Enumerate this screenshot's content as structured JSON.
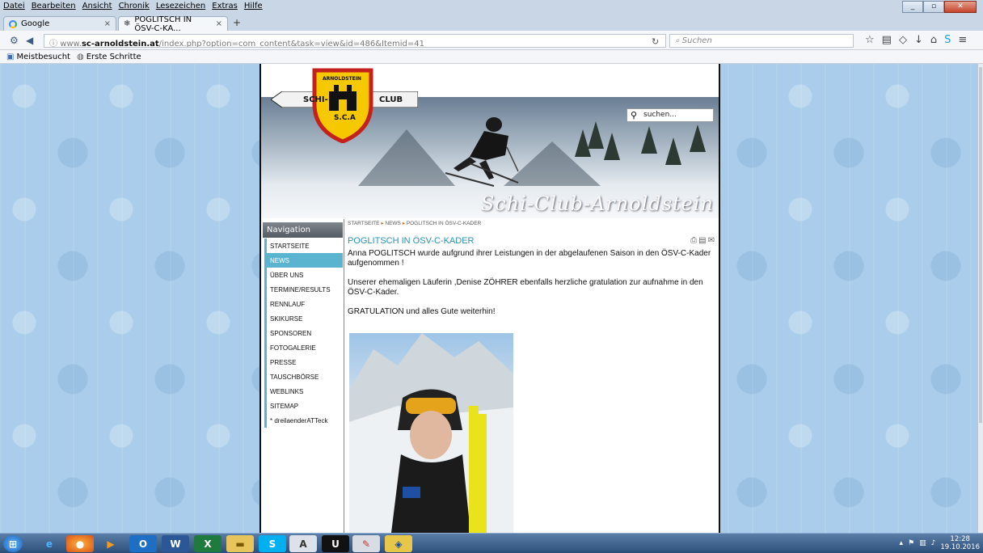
{
  "browser": {
    "menu": [
      "Datei",
      "Bearbeiten",
      "Ansicht",
      "Chronik",
      "Lesezeichen",
      "Extras",
      "Hilfe"
    ],
    "tabs": [
      {
        "label": "Google"
      },
      {
        "label": "POGLITSCH IN ÖSV-C-KA..."
      }
    ],
    "url_prefix": "www.",
    "url_domain": "sc-arnoldstein.at",
    "url_path": "/index.php?option=com_content&task=view&id=486&Itemid=41",
    "search_placeholder": "Suchen",
    "bookmarks": [
      "Meistbesucht",
      "Erste Schritte"
    ]
  },
  "site": {
    "logo_top_text": "ARNOLDSTEIN",
    "logo_ribbon_left": "SCHI-",
    "logo_ribbon_right": "CLUB",
    "logo_bottom_text": "S.C.A",
    "banner_title": "Schi-Club-Arnoldstein",
    "search_placeholder": "suchen...",
    "nav": {
      "heading": "Navigation",
      "items": [
        {
          "label": "STARTSEITE",
          "active": false
        },
        {
          "label": "NEWS",
          "active": true
        },
        {
          "label": "ÜBER UNS",
          "active": false
        },
        {
          "label": "TERMINE/RESULTS",
          "active": false
        },
        {
          "label": "RENNLAUF",
          "active": false
        },
        {
          "label": "SKIKURSE",
          "active": false
        },
        {
          "label": "SPONSOREN",
          "active": false
        },
        {
          "label": "FOTOGALERIE",
          "active": false
        },
        {
          "label": "PRESSE",
          "active": false
        },
        {
          "label": "TAUSCHBÖRSE",
          "active": false
        },
        {
          "label": "WEBLINKS",
          "active": false
        },
        {
          "label": "SITEMAP",
          "active": false
        },
        {
          "label": "* dreilaenderATTeck",
          "active": false
        }
      ]
    },
    "breadcrumb": [
      "STARTSEITE",
      "NEWS",
      "POGLITSCH IN ÖSV-C-KADER"
    ],
    "article": {
      "title": "POGLITSCH IN ÖSV-C-KADER",
      "p1": "Anna POGLITSCH wurde aufgrund ihrer Leistungen in der abgelaufenen Saison in den ÖSV-C-Kader aufgenommen !",
      "p2": "Unserer ehemaligen Läuferin ,Denise ZÖHRER ebenfalls herzliche gratulation zur aufnahme in den ÖSV-C-Kader.",
      "p3": "GRATULATION und alles Gute weiterhin!"
    }
  },
  "taskbar": {
    "time": "12:28",
    "date": "19.10.2016"
  },
  "colors": {
    "accent": "#5ab4cf",
    "title": "#2a8fb5",
    "page_bg": "#a9cdea"
  }
}
